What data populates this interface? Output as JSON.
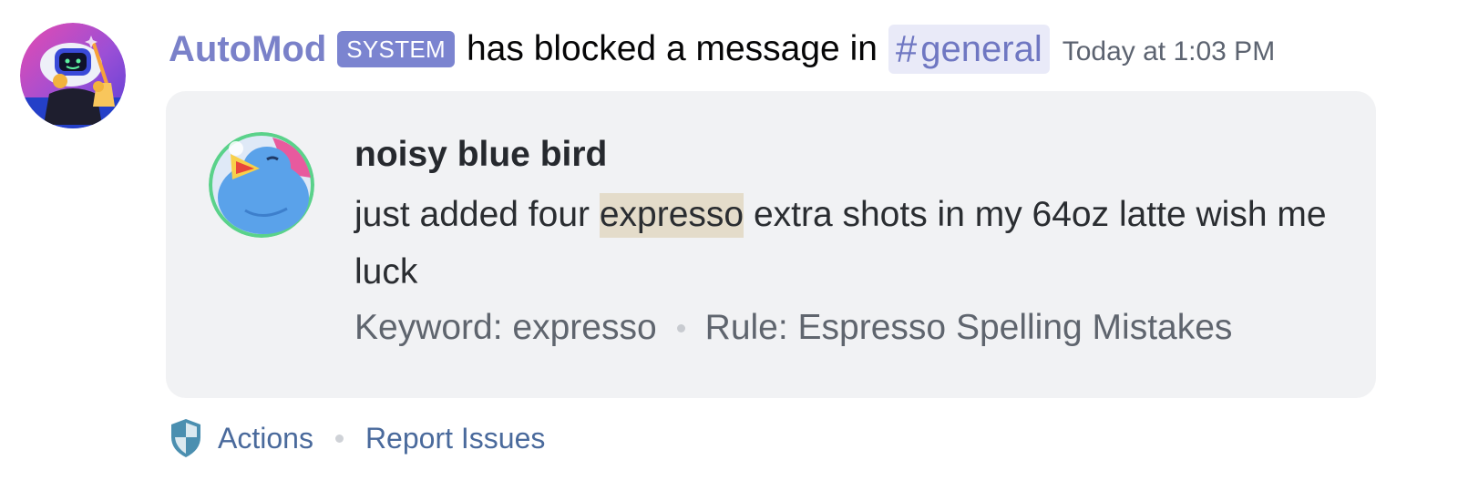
{
  "message": {
    "author": "AutoMod",
    "badge": "SYSTEM",
    "action_text": "has blocked a message in",
    "channel_hash": "#",
    "channel_name": "general",
    "timestamp": "Today at 1:03 PM"
  },
  "blocked_message": {
    "author": "noisy blue bird",
    "content_before": "just added four ",
    "keyword": "expresso",
    "content_after": " extra shots in my 64oz latte wish me luck",
    "keyword_label": "Keyword: expresso",
    "rule_label": "Rule: Espresso Spelling Mistakes"
  },
  "actions": {
    "actions_label": "Actions",
    "report_label": "Report Issues"
  },
  "colors": {
    "author": "#7a81c9",
    "badge_bg": "#7b84d0",
    "mention_bg": "#e9eaf8",
    "embed_bg": "#f1f2f4",
    "keyword_highlight": "#e4dcca",
    "link": "#4a6a9c"
  },
  "icons": {
    "automod_avatar": "automod-robot-icon",
    "bird_avatar": "blue-bird-icon",
    "shield": "shield-icon"
  }
}
